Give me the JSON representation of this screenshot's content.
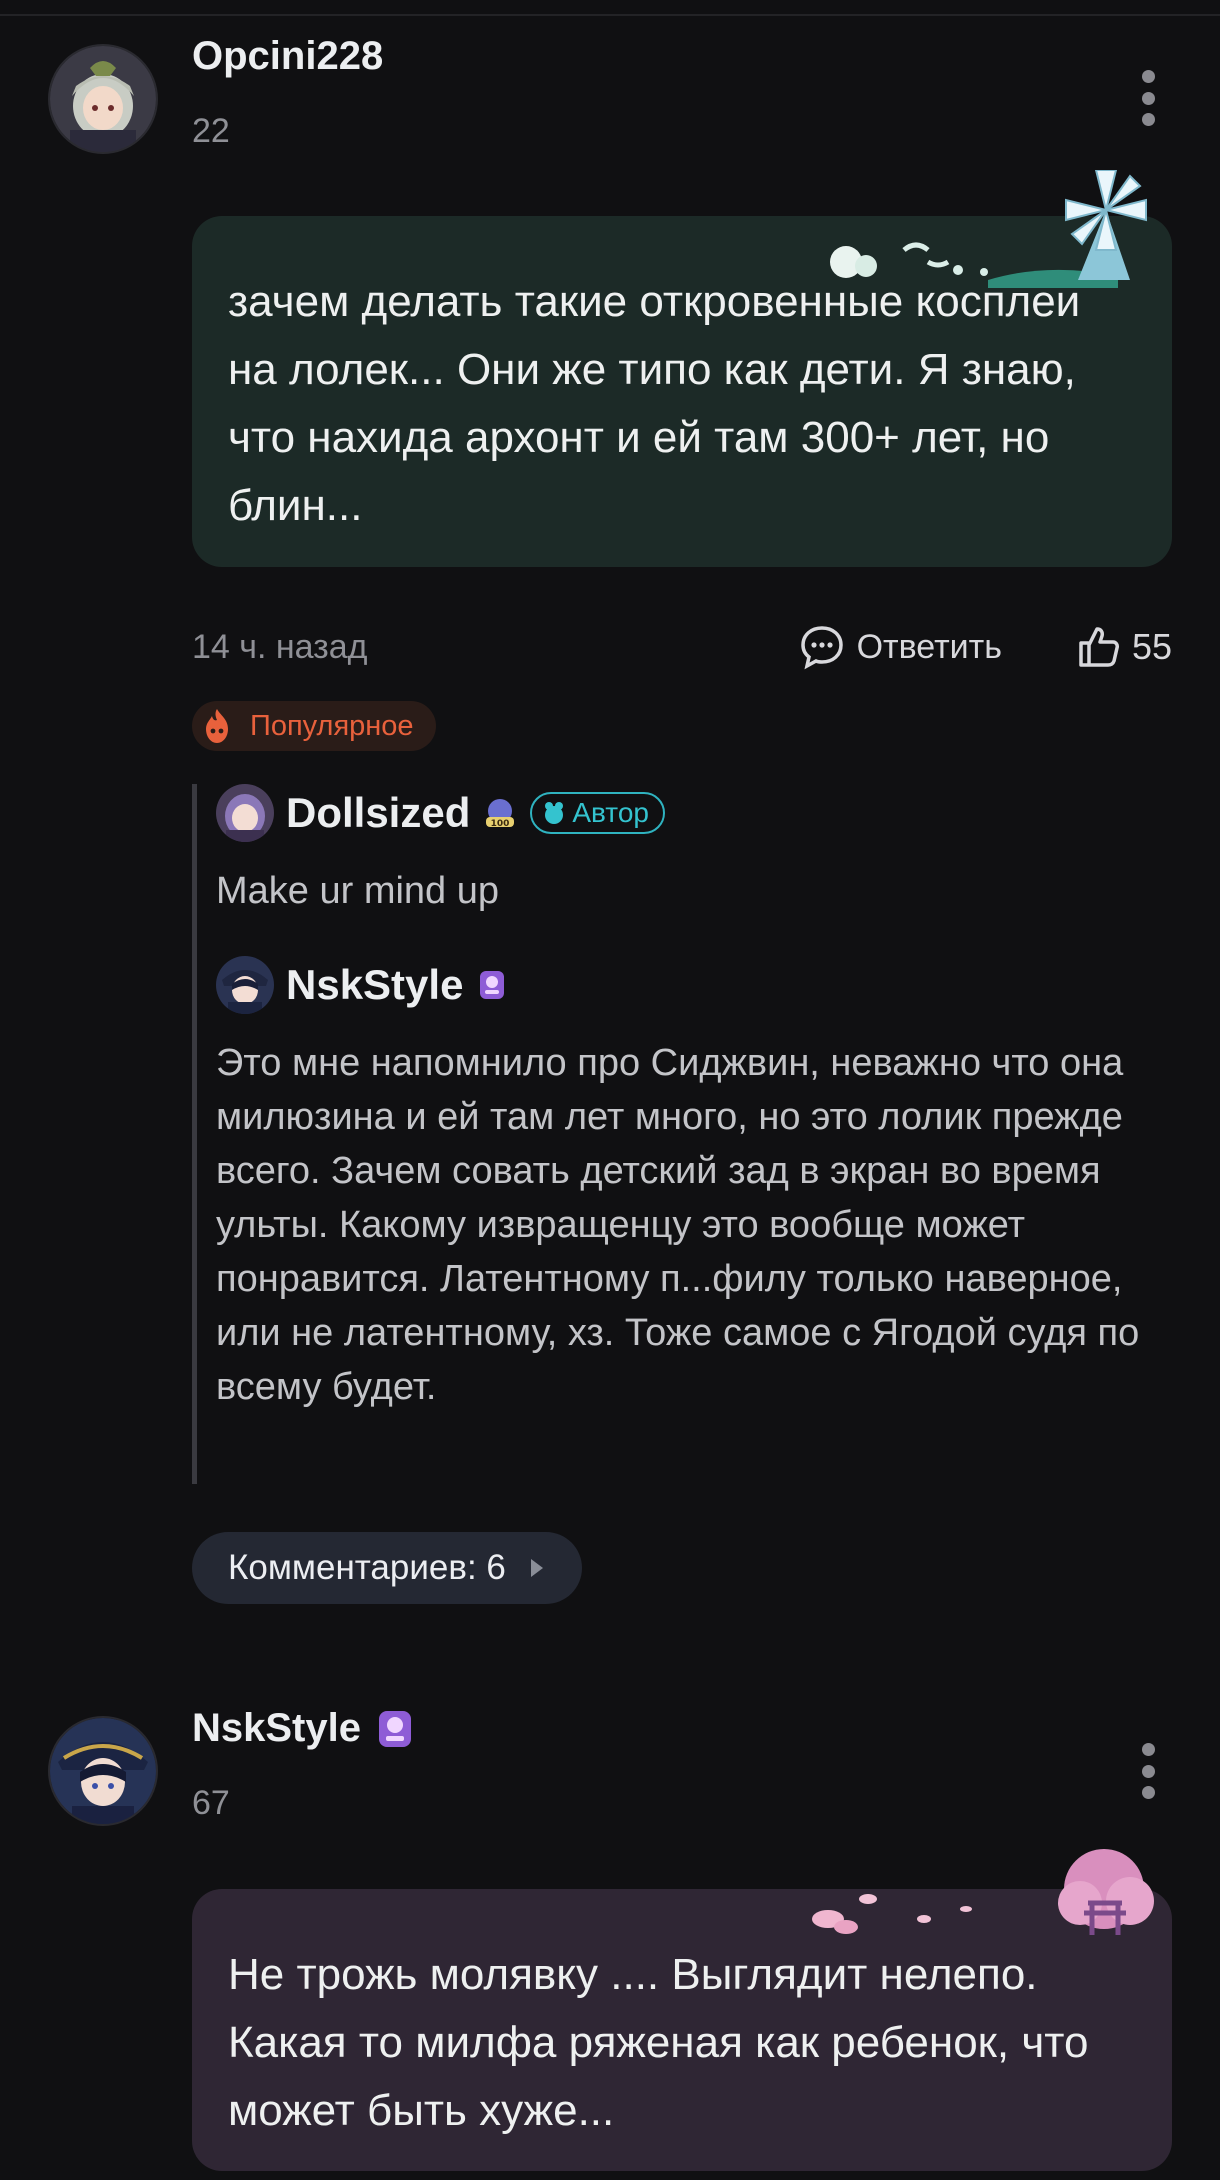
{
  "comments": [
    {
      "username": "Opcini228",
      "level": "22",
      "text": "зачем делать такие откровенные косплеи на лолек... Они же типо как дети. Я знаю, что нахида архонт и ей там 300+ лет, но блин...",
      "time": "14 ч. назад",
      "reply_label": "Ответить",
      "likes": "55",
      "badge": "Популярное",
      "replies": [
        {
          "username": "Dollsized",
          "author_badge": "Автор",
          "text": "Make ur mind up"
        },
        {
          "username": "NskStyle",
          "text": "Это мне напомнило про Сиджвин, неважно что она милюзина и ей там лет много, но это лолик прежде всего. Зачем совать детский зад в экран во время ульты. Какому извращенцу это вообще может понравится. Латентному п...филу только наверное, или не латентному, хз. Тоже самое с Ягодой судя по всему будет."
        }
      ],
      "more_comments": "Комментариев: 6"
    },
    {
      "username": "NskStyle",
      "level": "67",
      "text": "Не трожь молявку .... Выглядит нелепо. Какая то милфа ряженая как ребенок, что может быть хуже..."
    }
  ],
  "icons": {
    "more": "more-vertical-icon",
    "reply": "chat-bubble-icon",
    "like": "thumbs-up-icon",
    "fire": "fire-icon",
    "chevron": "chevron-right-icon"
  },
  "colors": {
    "background": "#101012",
    "bubble_green": "#1c2a27",
    "bubble_purple": "#2f2634",
    "popular_accent": "#e8613c",
    "author_accent": "#34c3cf"
  }
}
